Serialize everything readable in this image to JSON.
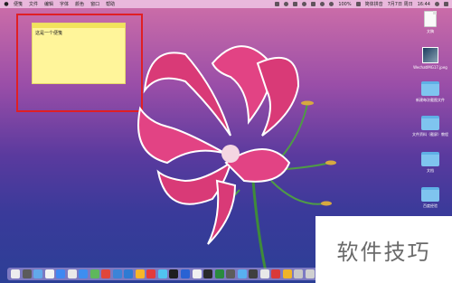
{
  "menubar": {
    "apple": "",
    "items": [
      "便笺",
      "文件",
      "编辑",
      "字体",
      "颜色",
      "窗口",
      "帮助"
    ],
    "status": {
      "battery": "100%",
      "input": "简体拼音",
      "date": "7月7日 周日",
      "time": "16:44"
    }
  },
  "note": {
    "text": "这是一个便笺"
  },
  "desktop_icons": [
    {
      "type": "doc",
      "label": "文稿"
    },
    {
      "type": "pic",
      "label": "WechatIMG17.jpeg"
    },
    {
      "type": "folder",
      "label": "新建每次截图文件"
    },
    {
      "type": "folder",
      "label": "文件资料（截屏）教程"
    },
    {
      "type": "folder",
      "label": "文档"
    },
    {
      "type": "folder",
      "label": "百度经验"
    }
  ],
  "dock_colors": [
    "#eeeeee",
    "#5b5b5b",
    "#62a8ea",
    "#f2f2f2",
    "#3f88f2",
    "#e9e9e9",
    "#3d8ef0",
    "#5fb85c",
    "#e0463a",
    "#3b84d8",
    "#2e7bd3",
    "#f7b728",
    "#e23b3b",
    "#51c3f0",
    "#1e1e1e",
    "#2962d3",
    "#f0f0f0",
    "#2a2a2a",
    "#2a8a3e",
    "#5c5c5c",
    "#58b0f0",
    "#3f3f3f",
    "#e8e8e8",
    "#d93a3a",
    "#f0b428",
    "#c7c7c7",
    "#d0d0d0"
  ],
  "watermark": {
    "text": "软件技巧"
  }
}
